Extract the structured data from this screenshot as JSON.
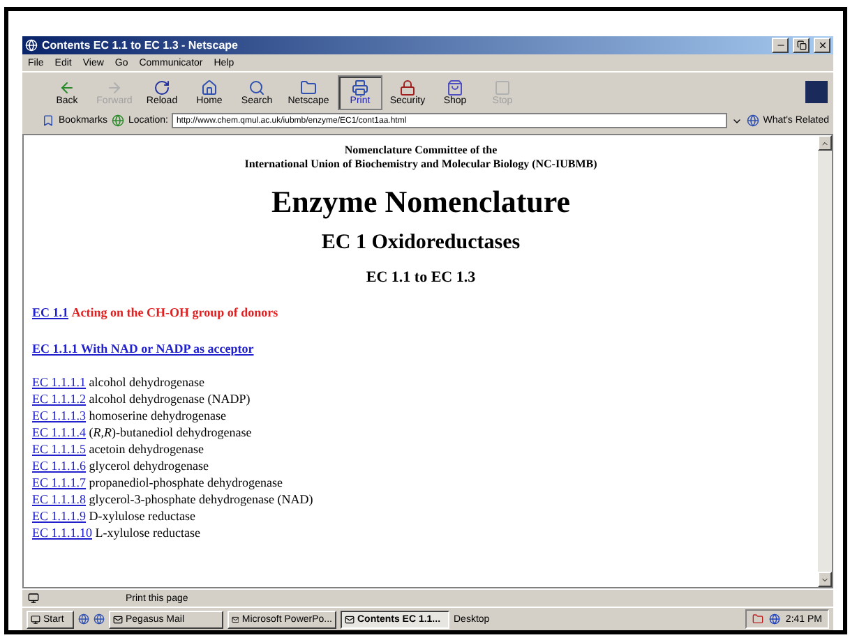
{
  "window": {
    "title": "Contents EC 1.1 to EC 1.3 - Netscape"
  },
  "menu": [
    "File",
    "Edit",
    "View",
    "Go",
    "Communicator",
    "Help"
  ],
  "toolbar": [
    {
      "label": "Back",
      "kind": "back",
      "disabled": false,
      "selected": false
    },
    {
      "label": "Forward",
      "kind": "forward",
      "disabled": true,
      "selected": false
    },
    {
      "label": "Reload",
      "kind": "reload",
      "disabled": false,
      "selected": false
    },
    {
      "label": "Home",
      "kind": "home",
      "disabled": false,
      "selected": false
    },
    {
      "label": "Search",
      "kind": "search",
      "disabled": false,
      "selected": false
    },
    {
      "label": "Netscape",
      "kind": "netscape",
      "disabled": false,
      "selected": false
    },
    {
      "label": "Print",
      "kind": "print",
      "disabled": false,
      "selected": true
    },
    {
      "label": "Security",
      "kind": "security",
      "disabled": false,
      "selected": false
    },
    {
      "label": "Shop",
      "kind": "shop",
      "disabled": false,
      "selected": false
    },
    {
      "label": "Stop",
      "kind": "stop",
      "disabled": true,
      "selected": false
    }
  ],
  "location": {
    "bookmarks": "Bookmarks",
    "label": "Location:",
    "url": "http://www.chem.qmul.ac.uk/iubmb/enzyme/EC1/cont1aa.html",
    "related": "What's Related"
  },
  "page": {
    "committee": [
      "Nomenclature Committee of the",
      "International Union of Biochemistry and Molecular Biology (NC-IUBMB)"
    ],
    "title": "Enzyme Nomenclature",
    "subtitle": "EC 1 Oxidoreductases",
    "range": "EC 1.1 to EC 1.3",
    "section": {
      "code": "EC 1.1",
      "title": "Acting on the CH-OH group of donors"
    },
    "subsection": "EC 1.1.1 With NAD or NADP as acceptor",
    "entries": [
      {
        "code": "EC 1.1.1.1",
        "name": "alcohol dehydrogenase"
      },
      {
        "code": "EC 1.1.1.2",
        "name": "alcohol dehydrogenase (NADP)"
      },
      {
        "code": "EC 1.1.1.3",
        "name": "homoserine dehydrogenase"
      },
      {
        "code": "EC 1.1.1.4",
        "name": "(*R,R*)-butanediol dehydrogenase"
      },
      {
        "code": "EC 1.1.1.5",
        "name": "acetoin dehydrogenase"
      },
      {
        "code": "EC 1.1.1.6",
        "name": "glycerol dehydrogenase"
      },
      {
        "code": "EC 1.1.1.7",
        "name": "propanediol-phosphate dehydrogenase"
      },
      {
        "code": "EC 1.1.1.8",
        "name": "glycerol-3-phosphate dehydrogenase (NAD)"
      },
      {
        "code": "EC 1.1.1.9",
        "name": "D-xylulose reductase"
      },
      {
        "code": "EC 1.1.1.10",
        "name": "L-xylulose reductase"
      }
    ]
  },
  "status_bar": {
    "text": "Print this page"
  },
  "taskbar": {
    "start": "Start",
    "tasks": [
      {
        "label": "Pegasus Mail",
        "selected": false
      },
      {
        "label": "Microsoft PowerPo...",
        "selected": false
      },
      {
        "label": "Contents EC 1.1...",
        "selected": true
      }
    ],
    "desktop": "Desktop",
    "clock": "2:41 PM"
  }
}
